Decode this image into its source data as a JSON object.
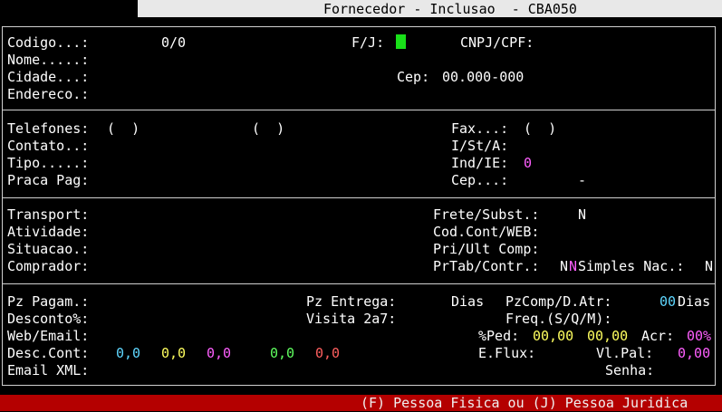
{
  "window": {
    "title": "Fornecedor - Inclusao  - CBA050"
  },
  "colors": {
    "status_bg": "#b40000",
    "cursor": "#19e019",
    "background": "#000000"
  },
  "section1": {
    "codigo_label": "Codigo...:",
    "codigo_value": "0/0",
    "fj_label": "F/J:",
    "cnpj_label": "CNPJ/CPF:",
    "nome_label": "Nome.....:",
    "cidade_label": "Cidade...:",
    "cep_label": "Cep:",
    "cep_value": "00.000-000",
    "endereco_label": "Endereco.:"
  },
  "section2": {
    "telefones_label": "Telefones:",
    "phone1": "(  )",
    "phone2": "(  )",
    "fax_label": "Fax...:",
    "fax_value": "(  )",
    "contato_label": "Contato..:",
    "ist_label": "I/St/A:",
    "tipo_label": "Tipo.....:",
    "indie_label": "Ind/IE:",
    "indie_value": "0",
    "praca_label": "Praca Pag:",
    "cep2_label": "Cep...:",
    "cep2_value": "-"
  },
  "section3": {
    "transport_label": "Transport:",
    "frete_label": "Frete/Subst.:",
    "frete_value": "N",
    "atividade_label": "Atividade:",
    "codcont_label": "Cod.Cont/WEB:",
    "situacao_label": "Situacao.:",
    "priult_label": "Pri/Ult Comp:",
    "comprador_label": "Comprador:",
    "prtab_label": "PrTab/Contr.:",
    "prtab_value1": "N",
    "prtab_value2": "N",
    "simples_label": "Simples Nac.:",
    "simples_value": "N"
  },
  "section4": {
    "pzpagam_label": "Pz Pagam.:",
    "pzentrega_label": "Pz Entrega:",
    "dias_label": "Dias",
    "pzcomp_label": "PzComp/D.Atr:",
    "pzcomp_value": "00",
    "pzcomp_unit": "Dias",
    "desconto_label": "Desconto%:",
    "visita_label": "Visita 2a7:",
    "freq_label": "Freq.(S/Q/M):",
    "web_label": "Web/Email:",
    "ped_label": "%Ped:",
    "ped_value": "00,00",
    "ped_value2": "00,00",
    "acr_label": "Acr:",
    "acr_value": "00%",
    "desccont_label": "Desc.Cont:",
    "desc_values": [
      "0,0",
      "0,0",
      "0,0",
      "0,0",
      "0,0"
    ],
    "eflux_label": "E.Flux:",
    "vlpal_label": "Vl.Pal:",
    "vlpal_value": "0,00",
    "emailxml_label": "Email XML:",
    "senha_label": "Senha:"
  },
  "status": {
    "message": "(F) Pessoa Fisica ou (J) Pessoa Juridica"
  }
}
